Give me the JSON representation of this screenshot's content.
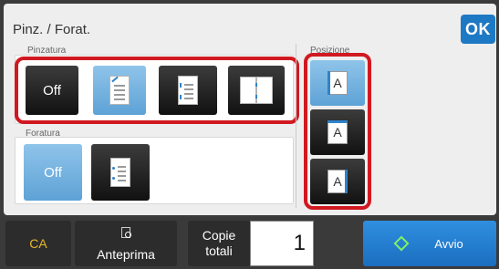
{
  "header": {
    "title": "Pinz. / Forat.",
    "ok_label": "OK"
  },
  "stapling": {
    "label": "Pinzatura",
    "options": [
      {
        "name": "off",
        "label": "Off",
        "selected": false
      },
      {
        "name": "corner",
        "icon": "staple-corner-icon",
        "selected": true
      },
      {
        "name": "two-left",
        "icon": "staple-two-left-icon",
        "selected": false
      },
      {
        "name": "saddle",
        "icon": "saddle-stitch-book-icon",
        "selected": false
      }
    ]
  },
  "punching": {
    "label": "Foratura",
    "options": [
      {
        "name": "off",
        "label": "Off",
        "selected": true
      },
      {
        "name": "punch-left",
        "icon": "punch-left-icon",
        "selected": false
      }
    ]
  },
  "position": {
    "label": "Posizione",
    "options": [
      {
        "name": "left",
        "glyph": "A",
        "icon": "position-left-icon",
        "selected": true
      },
      {
        "name": "top",
        "glyph": "A",
        "icon": "position-top-icon",
        "selected": false
      },
      {
        "name": "right",
        "glyph": "A",
        "icon": "position-right-icon",
        "selected": false
      }
    ]
  },
  "footer": {
    "ca_label": "CA",
    "preview_label": "Anteprima",
    "copies_label_line1": "Copie",
    "copies_label_line2": "totali",
    "copies_value": "1",
    "start_label": "Avvio"
  },
  "colors": {
    "accent": "#1d79c4",
    "selected": "#6aaedd",
    "highlight": "#d01920",
    "ca": "#e7b82a",
    "start_icon": "#7ef06a"
  }
}
